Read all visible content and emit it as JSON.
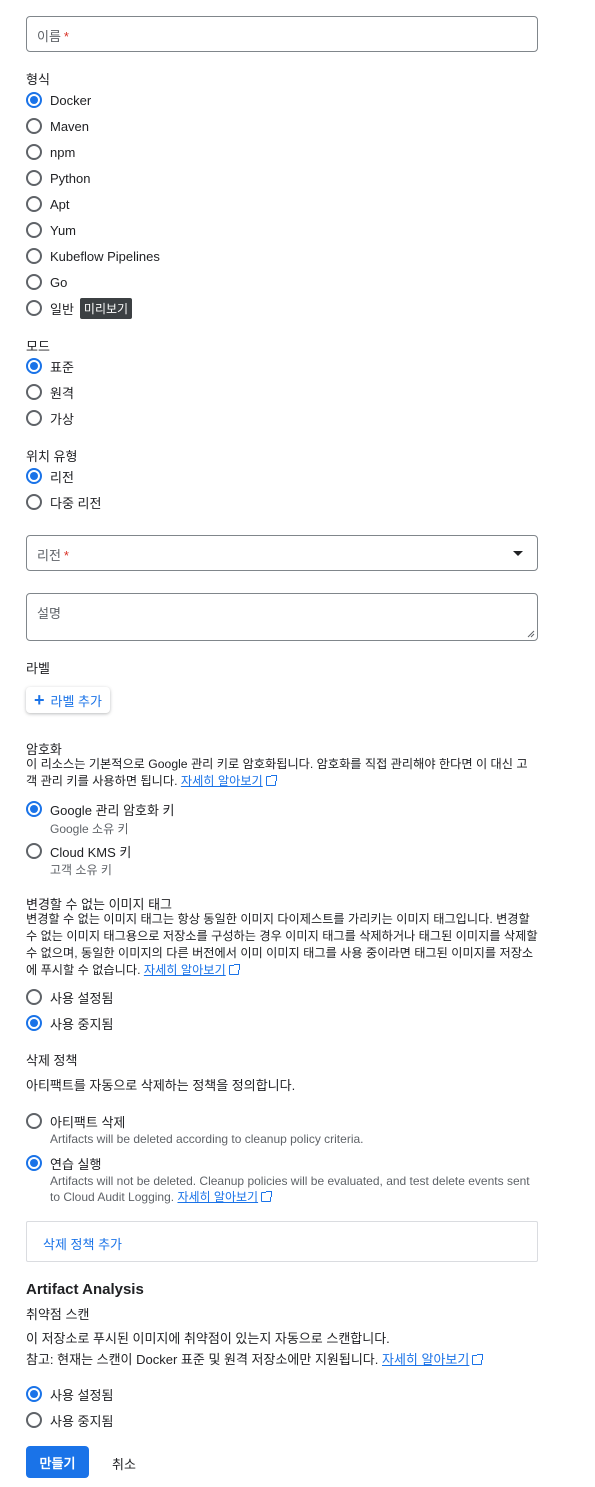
{
  "name_field": {
    "placeholder": "이름",
    "required": "*"
  },
  "format": {
    "title": "형식",
    "options": [
      "Docker",
      "Maven",
      "npm",
      "Python",
      "Apt",
      "Yum",
      "Kubeflow Pipelines",
      "Go",
      "일반"
    ],
    "selected": "Docker",
    "preview_badge": "미리보기"
  },
  "mode": {
    "title": "모드",
    "options": [
      "표준",
      "원격",
      "가상"
    ],
    "selected": "표준"
  },
  "location_type": {
    "title": "위치 유형",
    "options": [
      "리전",
      "다중 리전"
    ],
    "selected": "리전"
  },
  "region_field": {
    "placeholder": "리전",
    "required": "*"
  },
  "description_field": {
    "placeholder": "설명"
  },
  "labels": {
    "title": "라벨",
    "add_button": "라벨 추가"
  },
  "encryption": {
    "title": "암호화",
    "text": "이 리소스는 기본적으로 Google 관리 키로 암호화됩니다. 암호화를 직접 관리해야 한다면 이 대신 고객 관리 키를 사용하면 됩니다.",
    "learn_more": "자세히 알아보기",
    "options": [
      {
        "label": "Google 관리 암호화 키",
        "sub": "Google 소유 키"
      },
      {
        "label": "Cloud KMS 키",
        "sub": "고객 소유 키"
      }
    ],
    "selected": "Google 관리 암호화 키"
  },
  "immutable_tags": {
    "title": "변경할 수 없는 이미지 태그",
    "text": "변경할 수 없는 이미지 태그는 항상 동일한 이미지 다이제스트를 가리키는 이미지 태그입니다. 변경할 수 없는 이미지 태그용으로 저장소를 구성하는 경우 이미지 태그를 삭제하거나 태그된 이미지를 삭제할 수 없으며, 동일한 이미지의 다른 버전에서 이미 이미지 태그를 사용 중이라면 태그된 이미지를 저장소에 푸시할 수 없습니다.",
    "learn_more": "자세히 알아보기",
    "options": [
      "사용 설정됨",
      "사용 중지됨"
    ],
    "selected": "사용 중지됨"
  },
  "cleanup": {
    "title": "삭제 정책",
    "text": "아티팩트를 자동으로 삭제하는 정책을 정의합니다.",
    "options": [
      {
        "label": "아티팩트 삭제",
        "sub": "Artifacts will be deleted according to cleanup policy criteria."
      },
      {
        "label": "연습 실행",
        "sub": "Artifacts will not be deleted. Cleanup policies will be evaluated, and test delete events sent to Cloud Audit Logging."
      }
    ],
    "learn_more": "자세히 알아보기",
    "selected": "연습 실행",
    "add_policy": "삭제 정책 추가"
  },
  "artifact_analysis": {
    "title": "Artifact Analysis",
    "subtitle": "취약점 스캔",
    "text": "이 저장소로 푸시된 이미지에 취약점이 있는지 자동으로 스캔합니다.",
    "note": "참고: 현재는 스캔이 Docker 표준 및 원격 저장소에만 지원됩니다.",
    "learn_more": "자세히 알아보기",
    "options": [
      "사용 설정됨",
      "사용 중지됨"
    ],
    "selected": "사용 설정됨"
  },
  "actions": {
    "create": "만들기",
    "cancel": "취소"
  },
  "colors": {
    "accent": "#1a73e8",
    "required": "#d93025",
    "badge": "#3c4043"
  }
}
